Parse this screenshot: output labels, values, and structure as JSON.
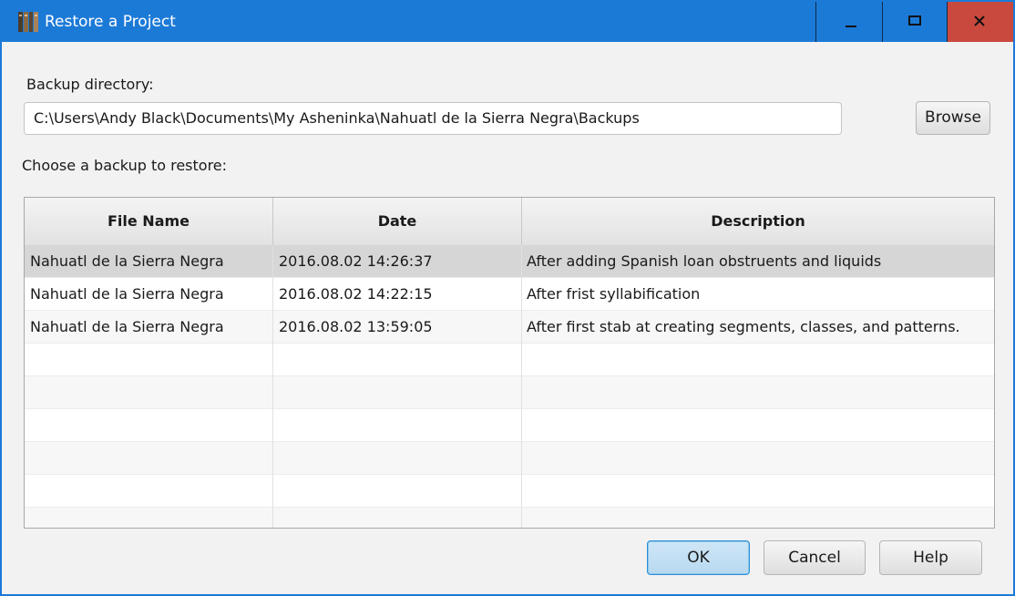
{
  "window": {
    "title": "Restore a Project",
    "titlebar_color": "#1c7ad7",
    "close_color": "#c9493f"
  },
  "form": {
    "backup_dir_label": "Backup directory:",
    "backup_dir_value": "C:\\Users\\Andy Black\\Documents\\My Asheninka\\Nahuatl de la Sierra Negra\\Backups",
    "browse_label": "Browse",
    "choose_label": "Choose a backup to restore:"
  },
  "table": {
    "columns": [
      "File Name",
      "Date",
      "Description"
    ],
    "rows": [
      {
        "file_name": "Nahuatl de la Sierra Negra",
        "date": "2016.08.02 14:26:37",
        "description": "After adding Spanish loan obstruents and liquids",
        "selected": true
      },
      {
        "file_name": "Nahuatl de la Sierra Negra",
        "date": "2016.08.02 14:22:15",
        "description": "After frist syllabification",
        "selected": false
      },
      {
        "file_name": "Nahuatl de la Sierra Negra",
        "date": "2016.08.02 13:59:05",
        "description": "After first stab at creating segments, classes, and patterns.",
        "selected": false
      }
    ],
    "empty_rows": 6
  },
  "buttons": {
    "ok": "OK",
    "cancel": "Cancel",
    "help": "Help"
  },
  "icons": {
    "app": "books-icon",
    "minimize": "minimize-icon",
    "maximize": "maximize-icon",
    "close": "close-icon"
  }
}
